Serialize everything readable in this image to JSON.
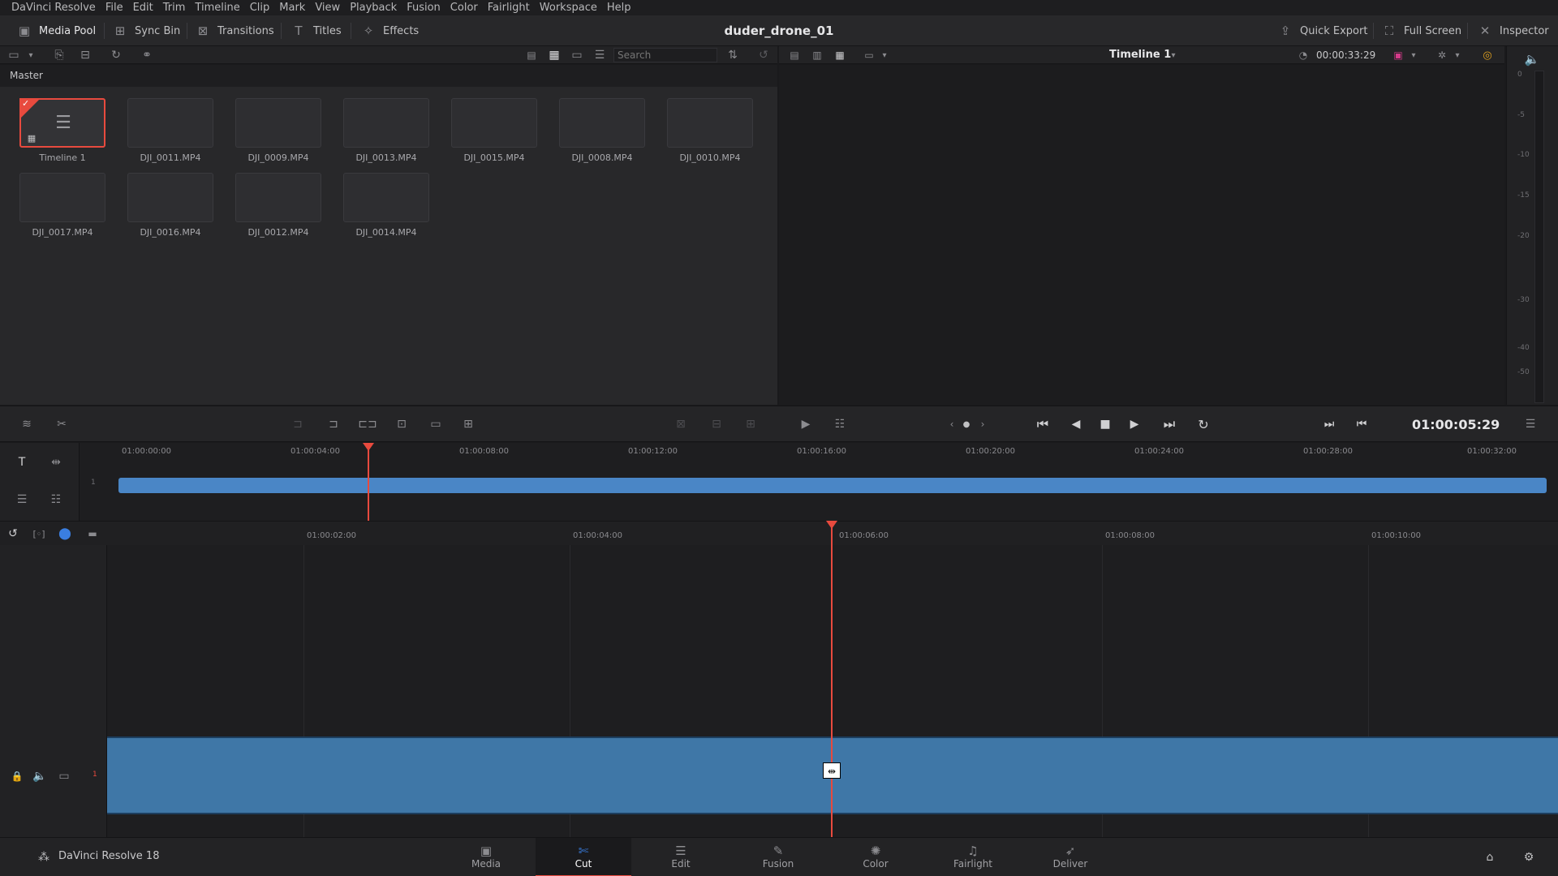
{
  "menu": [
    "DaVinci Resolve",
    "File",
    "Edit",
    "Trim",
    "Timeline",
    "Clip",
    "Mark",
    "View",
    "Playback",
    "Fusion",
    "Color",
    "Fairlight",
    "Workspace",
    "Help"
  ],
  "toolbar": {
    "media_pool": "Media Pool",
    "sync_bin": "Sync Bin",
    "transitions": "Transitions",
    "titles": "Titles",
    "effects": "Effects",
    "project_title": "duder_drone_01",
    "quick_export": "Quick Export",
    "full_screen": "Full Screen",
    "inspector": "Inspector"
  },
  "pool": {
    "search_placeholder": "Search",
    "breadcrumb": "Master",
    "items": [
      {
        "name": "Timeline 1",
        "selected": true
      },
      {
        "name": "DJI_0011.MP4"
      },
      {
        "name": "DJI_0009.MP4"
      },
      {
        "name": "DJI_0013.MP4"
      },
      {
        "name": "DJI_0015.MP4"
      },
      {
        "name": "DJI_0008.MP4"
      },
      {
        "name": "DJI_0010.MP4"
      },
      {
        "name": "DJI_0017.MP4"
      },
      {
        "name": "DJI_0016.MP4"
      },
      {
        "name": "DJI_0012.MP4"
      },
      {
        "name": "DJI_0014.MP4"
      }
    ]
  },
  "viewer": {
    "timecode_duration": "00:00:33:29",
    "timeline_name": "Timeline 1",
    "current_timecode": "01:00:05:29",
    "meter_labels": [
      "0",
      "-5",
      "-10",
      "-15",
      "-20",
      "-30",
      "-40",
      "-50"
    ]
  },
  "upper_ruler": [
    "01:00:00:00",
    "01:00:04:00",
    "01:00:08:00",
    "01:00:12:00",
    "01:00:16:00",
    "01:00:20:00",
    "01:00:24:00",
    "01:00:28:00",
    "01:00:32:00"
  ],
  "lower_ruler": [
    "01:00:02:00",
    "01:00:04:00",
    "01:00:06:00",
    "01:00:08:00",
    "01:00:10:00"
  ],
  "track_number": "1",
  "bottom": {
    "app_version": "DaVinci Resolve 18",
    "pages": [
      "Media",
      "Cut",
      "Edit",
      "Fusion",
      "Color",
      "Fairlight",
      "Deliver"
    ],
    "active_page": "Cut"
  },
  "colors": {
    "accent": "#e84a3e",
    "clip_blue": "#4a86c6",
    "track_blue": "#3f77a7"
  }
}
